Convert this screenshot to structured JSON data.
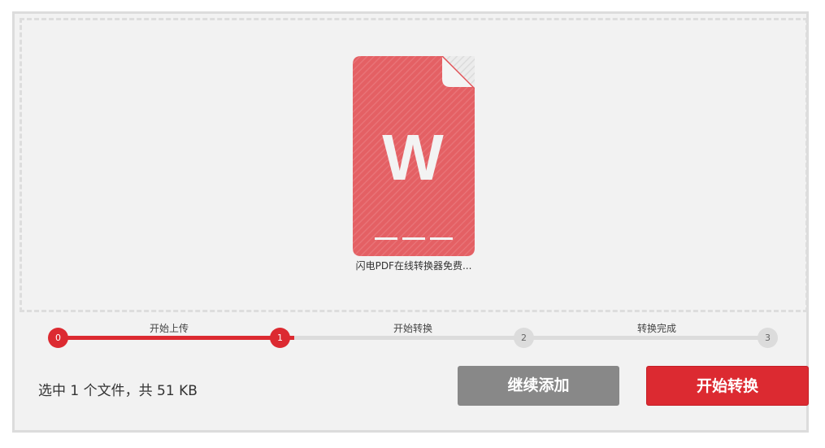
{
  "file": {
    "name": "闪电PDF在线转换器免费...",
    "icon_letter": "W",
    "icon": "word-document-icon",
    "icon_color": "#e46064"
  },
  "steps": [
    {
      "number": "0",
      "status": "done"
    },
    {
      "number": "1",
      "status": "done",
      "label": "开始上传"
    },
    {
      "number": "2",
      "status": "todo",
      "label": "开始转换"
    },
    {
      "number": "3",
      "status": "todo",
      "label": "转换完成"
    }
  ],
  "progress": {
    "completed_fraction": 0.3333
  },
  "summary": "选中 1 个文件，共 51 KB",
  "buttons": {
    "add_more": "继续添加",
    "start": "开始转换"
  },
  "colors": {
    "accent": "#dc2a31",
    "secondary_button": "#888888",
    "track": "#dcdcdc"
  }
}
